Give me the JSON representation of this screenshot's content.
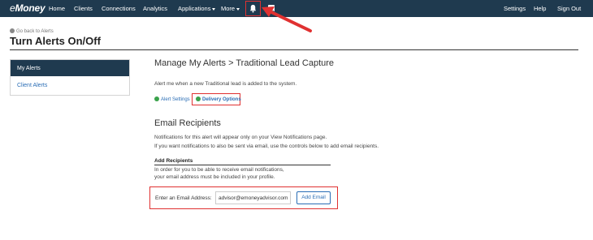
{
  "nav": {
    "logo_prefix": "e",
    "logo_main": "Money",
    "items": [
      "Home",
      "Clients",
      "Connections",
      "Analytics",
      "Applications",
      "More"
    ],
    "right_items": [
      "Settings",
      "Help",
      "Sign Out"
    ],
    "icons": [
      "bell-icon",
      "checkbox-icon"
    ]
  },
  "header": {
    "back_link": "Go back to Alerts",
    "title": "Turn Alerts On/Off"
  },
  "sidebar": {
    "items": [
      {
        "label": "My Alerts",
        "active": true
      },
      {
        "label": "Client Alerts",
        "active": false
      }
    ]
  },
  "main": {
    "title": "Manage My Alerts > Traditional Lead Capture",
    "description": "Alert me when a new Traditional lead is added to the system.",
    "alert_settings": "Alert Settings",
    "delivery_options": "Delivery Options"
  },
  "email": {
    "heading": "Email Recipients",
    "line1": "Notifications for this alert will appear only on your View Notifications page.",
    "line2": "If you want notifications to also be sent via email, use the controls below to add email recipients.",
    "add_title": "Add Recipients",
    "add_line1": "In order for you to be able to receive email notifications,",
    "add_line2": "your email address must be included in your profile.",
    "input_label": "Enter an Email Address:",
    "input_value": "advisor@emoneyadvisor.com",
    "add_button": "Add Email"
  },
  "colors": {
    "nav_bg": "#1f3a4f",
    "link": "#2a6db5",
    "highlight": "#e03131",
    "green": "#3aa24b"
  }
}
